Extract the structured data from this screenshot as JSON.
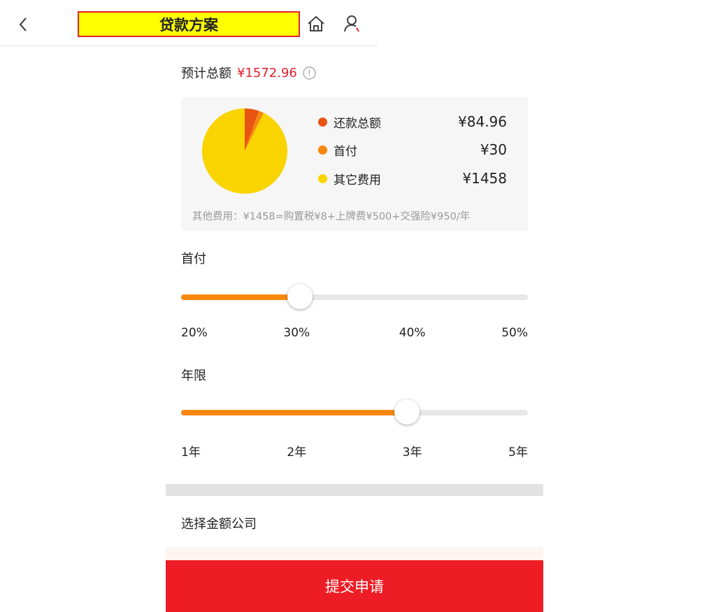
{
  "header": {
    "title": "贷款方案"
  },
  "total": {
    "label": "预计总额",
    "value": "¥1572.96"
  },
  "summary": {
    "legend": [
      {
        "name": "还款总额",
        "value": "¥84.96",
        "color": "#e85412"
      },
      {
        "name": "首付",
        "value": "¥30",
        "color": "#f7880f"
      },
      {
        "name": "其它费用",
        "value": "¥1458",
        "color": "#f9d400"
      }
    ],
    "note": "其他费用：¥1458=购置税¥8+上牌费¥500+交强险¥950/年"
  },
  "down_payment": {
    "label": "首付",
    "ticks": [
      "20%",
      "30%",
      "40%",
      "50%"
    ],
    "selected_index": 1,
    "selected_fraction": 0.3425
  },
  "term": {
    "label": "年限",
    "ticks": [
      "1年",
      "2年",
      "3年",
      "5年"
    ],
    "selected_index": 2,
    "selected_fraction": 0.6512
  },
  "company": {
    "label": "选择金额公司"
  },
  "submit": {
    "label": "提交申请"
  },
  "chart_data": {
    "type": "pie",
    "categories": [
      "还款总额",
      "首付",
      "其它费用"
    ],
    "values": [
      84.96,
      30,
      1458
    ],
    "colors": [
      "#e85412",
      "#f7880f",
      "#f9d400"
    ]
  }
}
